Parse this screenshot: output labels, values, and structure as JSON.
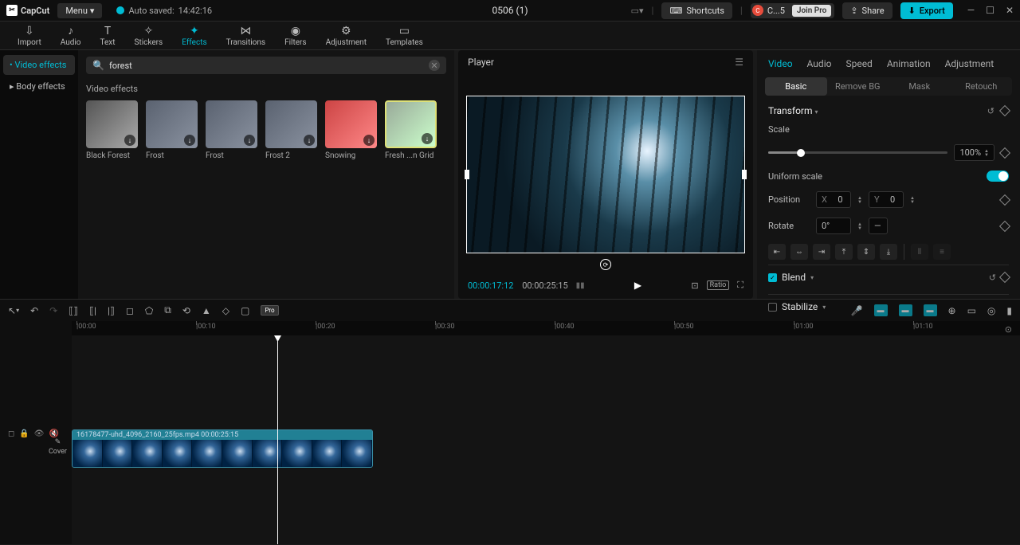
{
  "app": {
    "name": "CapCut",
    "menu_label": "Menu"
  },
  "auto_saved": {
    "label": "Auto saved:",
    "time": "14:42:16"
  },
  "project_title": "0506 (1)",
  "top_buttons": {
    "shortcuts": "Shortcuts",
    "user_initials": "C",
    "user_abbrev": "C...5",
    "join_pro": "Join Pro",
    "share": "Share",
    "export": "Export"
  },
  "nav": [
    {
      "label": "Import",
      "icon": "⇩"
    },
    {
      "label": "Audio",
      "icon": "♪"
    },
    {
      "label": "Text",
      "icon": "T"
    },
    {
      "label": "Stickers",
      "icon": "✧"
    },
    {
      "label": "Effects",
      "icon": "✦",
      "active": true
    },
    {
      "label": "Transitions",
      "icon": "⋈"
    },
    {
      "label": "Filters",
      "icon": "◉"
    },
    {
      "label": "Adjustment",
      "icon": "⚙"
    },
    {
      "label": "Templates",
      "icon": "▭"
    }
  ],
  "effects_sidebar": [
    {
      "label": "Video effects",
      "active": true
    },
    {
      "label": "Body effects",
      "active": false
    }
  ],
  "search": {
    "placeholder": "Search",
    "value": "forest"
  },
  "effects_section_label": "Video effects",
  "effects": [
    {
      "name": "Black Forest",
      "style": "bw"
    },
    {
      "name": "Frost",
      "style": ""
    },
    {
      "name": "Frost",
      "style": ""
    },
    {
      "name": "Frost 2",
      "style": ""
    },
    {
      "name": "Snowing",
      "style": "people"
    },
    {
      "name": "Fresh ...n Grid",
      "style": "grid"
    }
  ],
  "player": {
    "title": "Player",
    "current_time": "00:00:17:12",
    "duration": "00:00:25:15",
    "ratio_label": "Ratio"
  },
  "props": {
    "tabs": [
      "Video",
      "Audio",
      "Speed",
      "Animation",
      "Adjustment"
    ],
    "active_tab": "Video",
    "subtabs": [
      "Basic",
      "Remove BG",
      "Mask",
      "Retouch"
    ],
    "active_subtab": "Basic",
    "transform_label": "Transform",
    "scale_label": "Scale",
    "scale_value": "100%",
    "uniform_scale_label": "Uniform scale",
    "position_label": "Position",
    "pos_x_label": "X",
    "pos_x": "0",
    "pos_y_label": "Y",
    "pos_y": "0",
    "rotate_label": "Rotate",
    "rotate_value": "0°",
    "blend_label": "Blend",
    "stabilize_label": "Stabilize"
  },
  "timeline": {
    "clip_label": "16178477-uhd_4096_2160_25fps.mp4   00:00:25:15",
    "cover_label": "Cover",
    "ruler_marks": [
      "00:00",
      "00:10",
      "00:20",
      "00:30",
      "00:40",
      "00:50",
      "01:00",
      "01:10"
    ]
  }
}
